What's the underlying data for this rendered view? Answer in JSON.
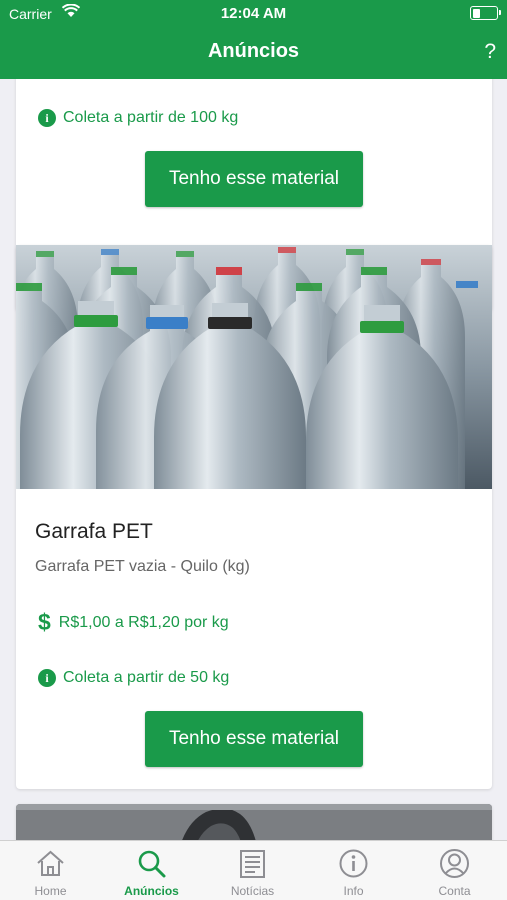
{
  "status": {
    "carrier": "Carrier",
    "time": "12:04 AM",
    "battery_fraction": 0.3
  },
  "nav": {
    "title": "Anúncios",
    "help": "?"
  },
  "colors": {
    "brand": "#1a9a4a"
  },
  "listings": [
    {
      "collection": "Coleta a partir de 100 kg",
      "button": "Tenho esse material"
    },
    {
      "title": "Garrafa PET",
      "subtitle": "Garrafa PET vazia - Quilo (kg)",
      "price_symbol": "$",
      "price": "R$1,00 a R$1,20 por kg",
      "collection": "Coleta a partir de 50 kg",
      "button": "Tenho esse material"
    }
  ],
  "icons": {
    "info": "i",
    "tabs": [
      "home-icon",
      "search-icon",
      "news-icon",
      "info-icon",
      "account-icon"
    ]
  },
  "tabs": [
    {
      "label": "Home"
    },
    {
      "label": "Anúncios"
    },
    {
      "label": "Notícias"
    },
    {
      "label": "Info"
    },
    {
      "label": "Conta"
    }
  ]
}
